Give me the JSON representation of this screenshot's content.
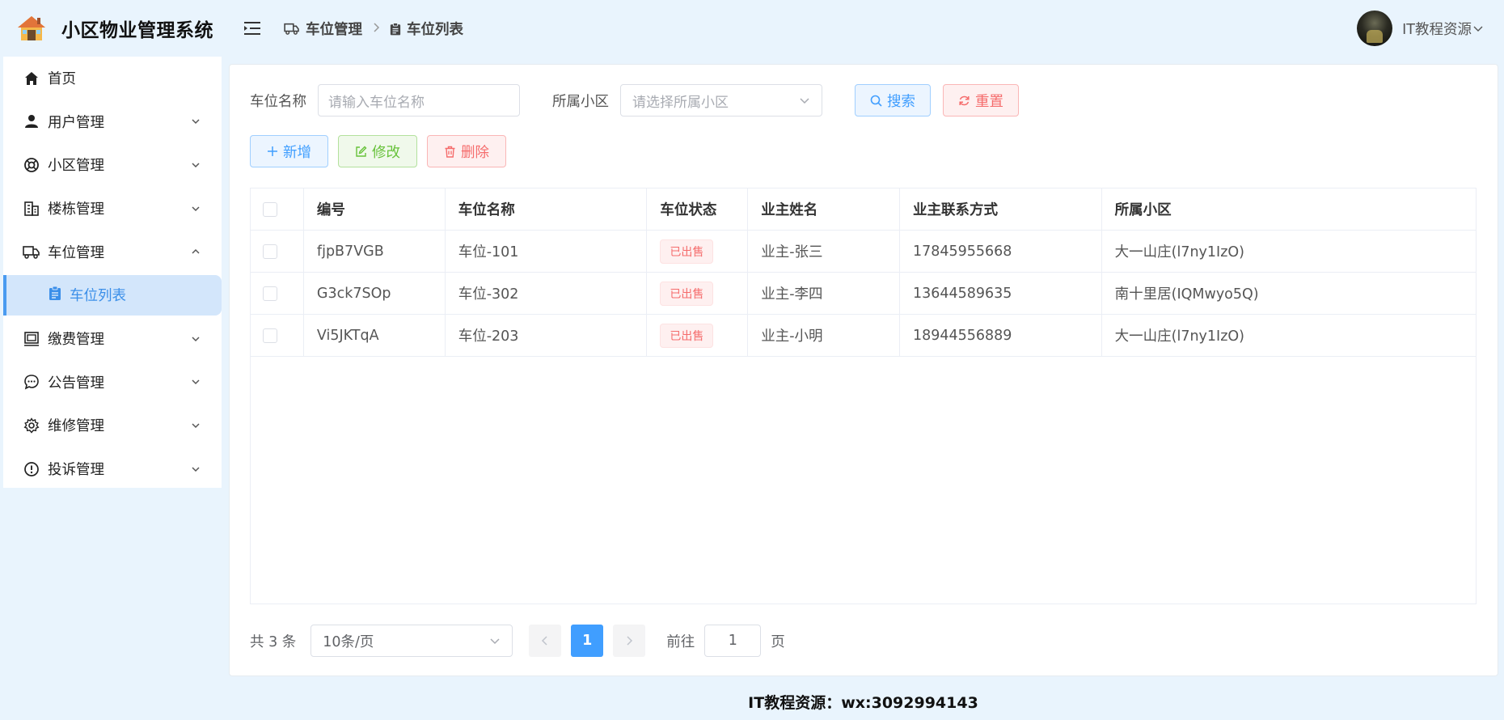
{
  "app": {
    "title": "小区物业管理系统"
  },
  "sidebar": {
    "items": [
      {
        "label": "首页",
        "icon": "home-icon"
      },
      {
        "label": "用户管理",
        "icon": "user-icon"
      },
      {
        "label": "小区管理",
        "icon": "lifebuoy-icon"
      },
      {
        "label": "楼栋管理",
        "icon": "building-icon"
      },
      {
        "label": "车位管理",
        "icon": "truck-icon"
      },
      {
        "label": "车位列表",
        "icon": "clipboard-icon"
      },
      {
        "label": "缴费管理",
        "icon": "payment-icon"
      },
      {
        "label": "公告管理",
        "icon": "chat-icon"
      },
      {
        "label": "维修管理",
        "icon": "gear-icon"
      },
      {
        "label": "投诉管理",
        "icon": "warning-icon"
      }
    ]
  },
  "header": {
    "breadcrumb": [
      "车位管理",
      "车位列表"
    ],
    "user": "IT教程资源"
  },
  "search": {
    "name_label": "车位名称",
    "name_placeholder": "请输入车位名称",
    "community_label": "所属小区",
    "community_placeholder": "请选择所属小区",
    "search_btn": "搜索",
    "reset_btn": "重置"
  },
  "actions": {
    "add": "新增",
    "edit": "修改",
    "delete": "删除"
  },
  "table": {
    "headers": [
      "编号",
      "车位名称",
      "车位状态",
      "业主姓名",
      "业主联系方式",
      "所属小区"
    ],
    "rows": [
      {
        "id": "fjpB7VGB",
        "name": "车位-101",
        "status": "已出售",
        "owner": "业主-张三",
        "phone": "17845955668",
        "community": "大一山庄(l7ny1IzO)"
      },
      {
        "id": "G3ck7SOp",
        "name": "车位-302",
        "status": "已出售",
        "owner": "业主-李四",
        "phone": "13644589635",
        "community": "南十里居(IQMwyo5Q)"
      },
      {
        "id": "Vi5JKTqA",
        "name": "车位-203",
        "status": "已出售",
        "owner": "业主-小明",
        "phone": "18944556889",
        "community": "大一山庄(l7ny1IzO)"
      }
    ]
  },
  "pagination": {
    "total": "共 3 条",
    "page_size": "10条/页",
    "current": "1",
    "goto_label": "前往",
    "goto_value": "1",
    "page_suffix": "页"
  },
  "footer": {
    "text": "IT教程资源：wx:3092994143"
  },
  "colors": {
    "accent": "#409eff",
    "danger": "#f56c6c",
    "success": "#67c23a",
    "background": "#e9f4fd"
  }
}
